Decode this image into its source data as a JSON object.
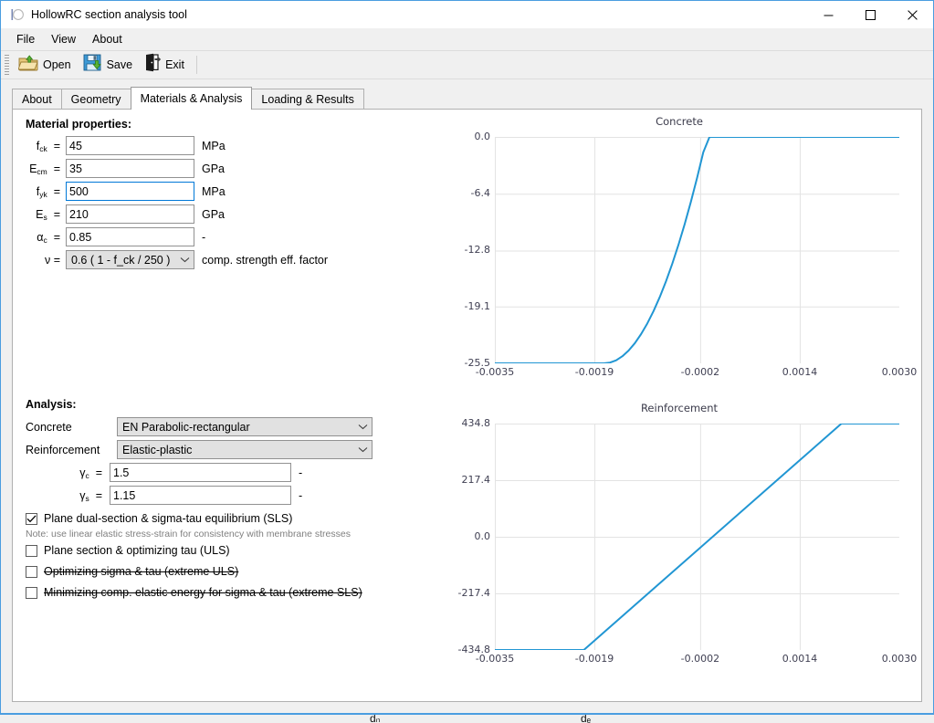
{
  "window": {
    "title": "HollowRC section analysis tool",
    "icon": "app-icon",
    "minimize_label": "—",
    "maximize_label": "□",
    "close_label": "✕"
  },
  "menubar": {
    "items": [
      {
        "label": "File"
      },
      {
        "label": "View"
      },
      {
        "label": "About"
      }
    ]
  },
  "toolbar": {
    "items": [
      {
        "label": "Open",
        "icon": "open-folder-icon"
      },
      {
        "label": "Save",
        "icon": "save-floppy-icon"
      },
      {
        "label": "Exit",
        "icon": "exit-door-icon"
      }
    ]
  },
  "tabs": [
    {
      "label": "About",
      "active": false
    },
    {
      "label": "Geometry",
      "active": false
    },
    {
      "label": "Materials & Analysis",
      "active": true
    },
    {
      "label": "Loading & Results",
      "active": false
    }
  ],
  "material": {
    "heading": "Material properties:",
    "rows": [
      {
        "symbol": "f",
        "sub": "ck",
        "value": "45",
        "unit": "MPa",
        "focused": false
      },
      {
        "symbol": "E",
        "sub": "cm",
        "value": "35",
        "unit": "GPa",
        "focused": false
      },
      {
        "symbol": "f",
        "sub": "yk",
        "value": "500",
        "unit": "MPa",
        "focused": true
      },
      {
        "symbol": "E",
        "sub": "s",
        "value": "210",
        "unit": "GPa",
        "focused": false
      },
      {
        "symbol": "α",
        "sub": "c",
        "value": "0.85",
        "unit": "-",
        "focused": false
      }
    ],
    "nu_label": "ν  =",
    "nu_value": "0.6 ( 1 - f_ck / 250 )",
    "nu_unit": "comp. strength eff. factor"
  },
  "analysis": {
    "heading": "Analysis:",
    "concrete_label": "Concrete",
    "concrete_value": "EN Parabolic-rectangular",
    "reinforcement_label": "Reinforcement",
    "reinforcement_value": "Elastic-plastic",
    "gamma_c_label": "γ",
    "gamma_c_sub": "c",
    "gamma_c_value": "1.5",
    "gamma_c_unit": "-",
    "gamma_s_label": "γ",
    "gamma_s_sub": "s",
    "gamma_s_value": "1.15",
    "gamma_s_unit": "-",
    "checkboxes": [
      {
        "label": "Plane dual-section & sigma-tau equilibrium (SLS)",
        "checked": true,
        "struck": false
      },
      {
        "label": "Plane section & optimizing tau (ULS)",
        "checked": false,
        "struck": false
      },
      {
        "label": "Optimizing sigma & tau (extreme ULS)",
        "checked": false,
        "struck": true
      },
      {
        "label": "Minimizing comp. elastic energy for sigma & tau (extreme SLS)",
        "checked": false,
        "struck": true
      }
    ],
    "note": "Note: use linear elastic stress-strain for consistency with membrane stresses"
  },
  "chart_data": [
    {
      "type": "line",
      "title": "Concrete",
      "xlabel": "",
      "ylabel": "",
      "xlim": [
        -0.0035,
        0.003
      ],
      "ylim": [
        -25.5,
        0.0
      ],
      "xticks": [
        -0.0035,
        -0.0019,
        -0.0002,
        0.0014,
        0.003
      ],
      "xticklabels": [
        "-0.0035",
        "-0.0019",
        "-0.0002",
        "0.0014",
        "0.0030"
      ],
      "yticks": [
        -25.5,
        -19.1,
        -12.8,
        -6.4,
        0.0
      ],
      "yticklabels": [
        "-25.5",
        "-19.1",
        "-12.8",
        "-6.4",
        "0.0"
      ],
      "grid": true,
      "legend": null,
      "line_color": "#2196d3",
      "series": [
        {
          "name": "EN Parabolic-rectangular",
          "x": [
            -0.0035,
            -0.003,
            -0.0025,
            -0.002,
            -0.00175,
            -0.00165,
            -0.00155,
            -0.00145,
            -0.00135,
            -0.00125,
            -0.00115,
            -0.00105,
            -0.00095,
            -0.00085,
            -0.00075,
            -0.00065,
            -0.00055,
            -0.00045,
            -0.00035,
            -0.00025,
            -0.00015,
            -5e-05,
            0.0,
            0.001,
            0.002,
            0.003
          ],
          "y": [
            -25.5,
            -25.5,
            -25.5,
            -25.5,
            -25.5,
            -25.42,
            -25.16,
            -24.7,
            -24.06,
            -23.23,
            -22.21,
            -21.01,
            -19.62,
            -18.04,
            -16.27,
            -14.31,
            -12.17,
            -9.84,
            -7.32,
            -4.61,
            -1.72,
            0.0,
            0.0,
            0.0,
            0.0,
            0.0
          ]
        }
      ]
    },
    {
      "type": "line",
      "title": "Reinforcement",
      "xlabel": "",
      "ylabel": "",
      "xlim": [
        -0.0035,
        0.003
      ],
      "ylim": [
        -434.8,
        434.8
      ],
      "xticks": [
        -0.0035,
        -0.0019,
        -0.0002,
        0.0014,
        0.003
      ],
      "xticklabels": [
        "-0.0035",
        "-0.0019",
        "-0.0002",
        "0.0014",
        "0.0030"
      ],
      "yticks": [
        -434.8,
        -217.4,
        0.0,
        217.4,
        434.8
      ],
      "yticklabels": [
        "-434.8",
        "-217.4",
        "0.0",
        "217.4",
        "434.8"
      ],
      "grid": true,
      "legend": null,
      "line_color": "#2196d3",
      "series": [
        {
          "name": "Elastic-plastic",
          "x": [
            -0.0035,
            -0.00207,
            0.00207,
            0.003
          ],
          "y": [
            -434.8,
            -434.8,
            434.8,
            434.8
          ]
        }
      ]
    }
  ]
}
